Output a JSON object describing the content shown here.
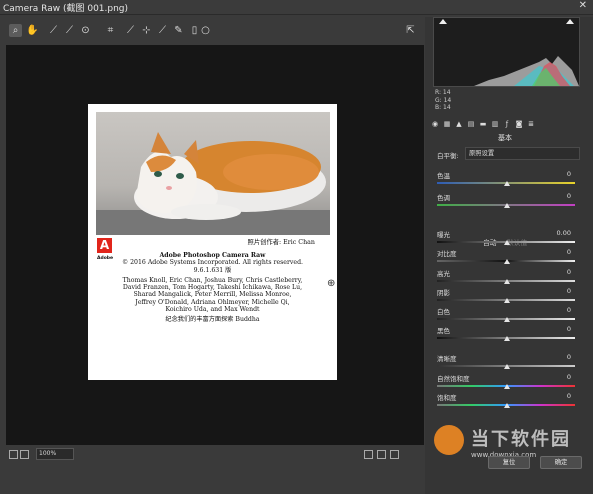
{
  "window": {
    "title": "Camera Raw (截图 001.png)",
    "close": "✕"
  },
  "toolbar": {
    "tools": [
      {
        "name": "zoom-icon",
        "glyph": "🔍"
      },
      {
        "name": "hand-icon",
        "glyph": "✋"
      },
      {
        "name": "white-balance-icon",
        "glyph": "⟋"
      },
      {
        "name": "color-sampler-icon",
        "glyph": "⟋"
      },
      {
        "name": "targeted-adjustment-icon",
        "glyph": "⊙"
      },
      {
        "name": "crop-icon",
        "glyph": "⌗"
      },
      {
        "name": "straighten-icon",
        "glyph": "⟋"
      },
      {
        "name": "spot-removal-icon",
        "glyph": "⟋"
      },
      {
        "name": "red-eye-icon",
        "glyph": "⊙"
      },
      {
        "name": "adjustment-brush-icon",
        "glyph": "✎"
      },
      {
        "name": "graduated-filter-icon",
        "glyph": "▭"
      },
      {
        "name": "radial-filter-icon",
        "glyph": "○"
      }
    ],
    "export_icon": "⇱"
  },
  "about": {
    "credit": "照片创作者: Eric Chan",
    "adobe_text": "Adobe",
    "product": "Adobe Photoshop Camera Raw",
    "copyright": "© 2016 Adobe Systems Incorporated. All rights reserved.",
    "version": "9.6.1.631 版",
    "contributors": [
      "Thomas Knoll, Eric Chan, Joshua Bury, Chris Castleberry,",
      "David Franzen, Tom Hogarty, Takeshi Ichikawa, Rose Lu,",
      "Sharad Mangalick, Peter Merrill, Melissa Monroe,",
      "Jeffrey O'Donald, Adriana Ohlmeyer, Michelle Qi,",
      "Koichiro Uda, and Max Wendt"
    ],
    "dedication": "纪念我们的丰富方面探索 Buddha"
  },
  "bottombar": {
    "zoom": "100%"
  },
  "rgb": {
    "r": "R:  14",
    "g": "G:  14",
    "b": "B:  14"
  },
  "panel": {
    "section_title": "基本",
    "white_balance_label": "白平衡:",
    "white_balance_value": "原照设置",
    "auto_label": "自动",
    "default_label": "默认值",
    "sliders_top": [
      {
        "label": "色温",
        "value": "0"
      },
      {
        "label": "色调",
        "value": "0"
      }
    ],
    "sliders_tone": [
      {
        "label": "曝光",
        "value": "0.00"
      },
      {
        "label": "对比度",
        "value": "0"
      },
      {
        "label": "高光",
        "value": "0"
      },
      {
        "label": "阴影",
        "value": "0"
      },
      {
        "label": "白色",
        "value": "0"
      },
      {
        "label": "黑色",
        "value": "0"
      }
    ],
    "sliders_presence": [
      {
        "label": "清晰度",
        "value": "0"
      },
      {
        "label": "自然饱和度",
        "value": "0"
      },
      {
        "label": "饱和度",
        "value": "0"
      }
    ],
    "reset_button": "复位",
    "ok_button": "确定"
  },
  "watermark": {
    "text": "当下软件园",
    "url": "www.downxia.com"
  }
}
